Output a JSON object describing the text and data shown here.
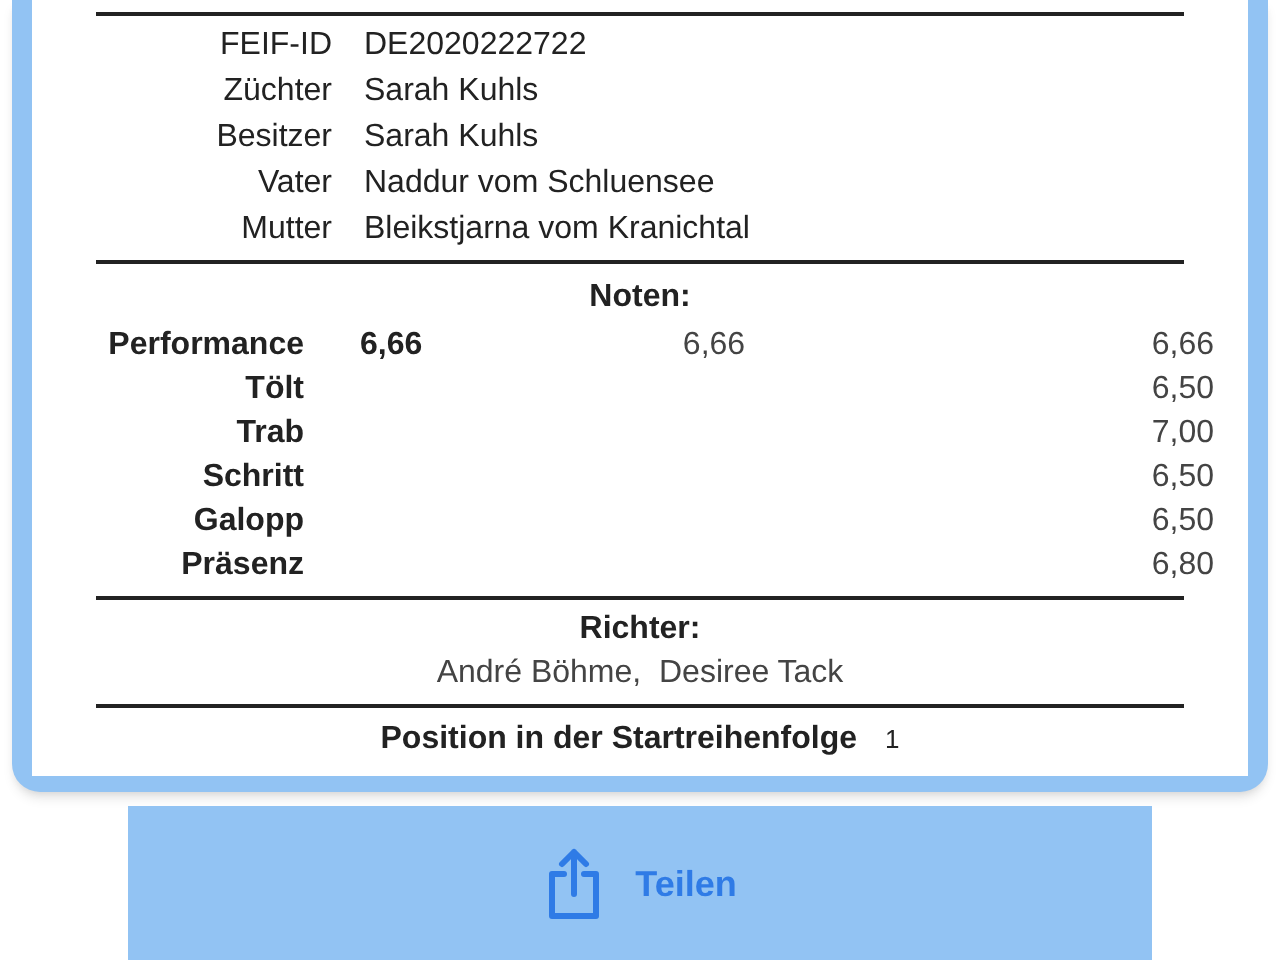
{
  "details": [
    {
      "label": "FEIF-ID",
      "value": "DE2020222722"
    },
    {
      "label": "Züchter",
      "value": "Sarah Kuhls"
    },
    {
      "label": "Besitzer",
      "value": "Sarah Kuhls"
    },
    {
      "label": "Vater",
      "value": "Naddur vom Schluensee"
    },
    {
      "label": "Mutter",
      "value": "Bleikstjarna vom Kranichtal"
    }
  ],
  "scores": {
    "title": "Noten:",
    "rows": [
      {
        "label": "Performance",
        "column_1": "6,66",
        "column_2": "6,66",
        "column_3": "6,66"
      },
      {
        "label": "Tölt",
        "column_3": "6,50"
      },
      {
        "label": "Trab",
        "column_3": "7,00"
      },
      {
        "label": "Schritt",
        "column_3": "6,50"
      },
      {
        "label": "Galopp",
        "column_3": "6,50"
      },
      {
        "label": "Präsenz",
        "column_3": "6,80"
      }
    ]
  },
  "judges": {
    "title": "Richter:",
    "names": "André Böhme,  Desiree Tack"
  },
  "start_position": {
    "label": "Position in der Startreihenfolge",
    "value": "1"
  },
  "share_button": {
    "label": "Teilen"
  }
}
